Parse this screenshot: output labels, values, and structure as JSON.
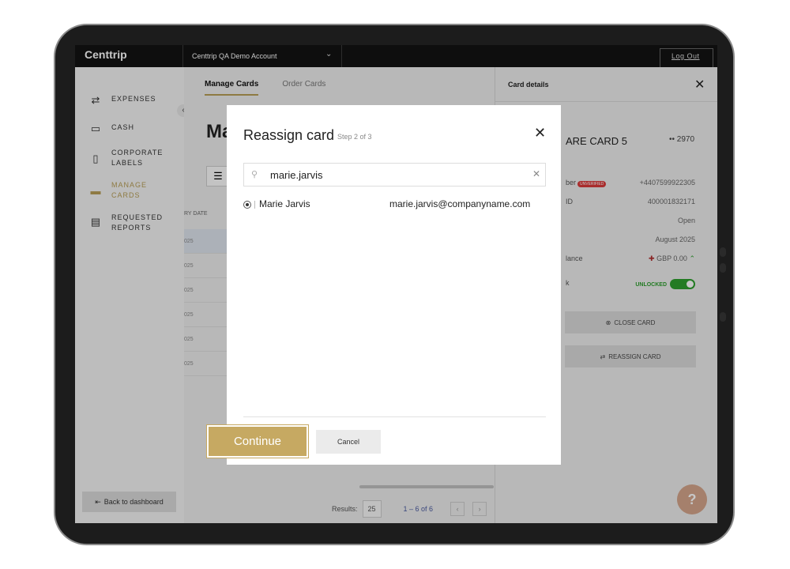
{
  "app": {
    "logo": "Centtrip",
    "account": "Centtrip QA Demo Account",
    "logout": "Log Out"
  },
  "sidebar": {
    "items": [
      {
        "label": "EXPENSES",
        "icon": "expenses-icon"
      },
      {
        "label": "CASH",
        "icon": "wallet-icon"
      },
      {
        "label": "CORPORATE LABELS",
        "icon": "label-icon"
      },
      {
        "label": "MANAGE CARDS",
        "icon": "cards-icon",
        "active": true
      },
      {
        "label": "REQUESTED REPORTS",
        "icon": "reports-icon"
      }
    ],
    "back": "Back to dashboard"
  },
  "main": {
    "tabs": [
      "Manage Cards",
      "Order Cards"
    ],
    "title": "Ma",
    "col_head": "RY DATE",
    "rows": [
      "025",
      "025",
      "025",
      "025",
      "025",
      "025"
    ],
    "results_label": "Results:",
    "page_size": "25",
    "pagination": "1 – 6 of 6"
  },
  "panel": {
    "title": "Card details",
    "card_name": "ARE CARD 5",
    "card_last": "•• 2970",
    "rows": [
      {
        "label": "ber",
        "badge": "UNVERIFIED",
        "value": "+4407599922305"
      },
      {
        "label": "ID",
        "value": "400001832171"
      },
      {
        "label": "",
        "value": "Open"
      },
      {
        "label": "",
        "value": "August 2025"
      },
      {
        "label": "lance",
        "value": "GBP 0.00"
      }
    ],
    "lock_label": "k",
    "lock_status": "UNLOCKED",
    "close_card": "CLOSE CARD",
    "reassign_card": "REASSIGN CARD"
  },
  "modal": {
    "title": "Reassign card",
    "step": "Step 2 of 3",
    "search_value": "marie.jarvis",
    "result": {
      "name": "Marie Jarvis",
      "email": "marie.jarvis@companyname.com"
    },
    "continue": "Continue",
    "cancel": "Cancel"
  },
  "colors": {
    "accent": "#c6a962",
    "sidebar_active": "#b69d55",
    "unlocked": "#2e9e2e",
    "badge": "#d93a3a"
  }
}
